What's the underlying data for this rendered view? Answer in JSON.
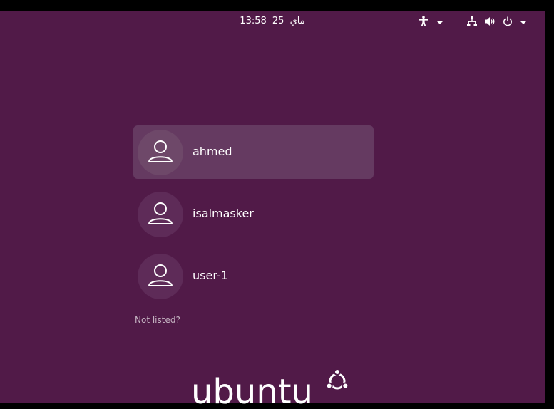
{
  "top_bar": {
    "time": "13:58",
    "day": "25",
    "month": "ماي",
    "icons": [
      "accessibility-icon",
      "network-icon",
      "volume-icon",
      "power-icon"
    ]
  },
  "users": [
    {
      "name": "ahmed",
      "selected": true
    },
    {
      "name": "isalmasker",
      "selected": false
    },
    {
      "name": "user-1",
      "selected": false
    }
  ],
  "not_listed_label": "Not listed?",
  "branding": {
    "logo_text": "ubuntu"
  },
  "colors": {
    "background": "#511a48",
    "selected_row": "#653a61",
    "avatar": "#5e2b58",
    "text": "#ffffff",
    "muted_text": "#c4b2c1"
  }
}
